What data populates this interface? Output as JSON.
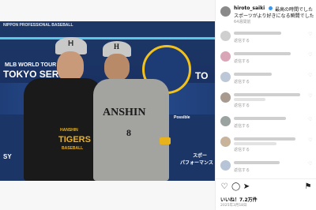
{
  "post": {
    "photo_alt": "Two baseball players posing in front of a stadium backdrop",
    "backdrop": {
      "top_text": "NIPPON PROFESSIONAL BASEBALL",
      "mlb_text": "MLB WORLD TOUR",
      "tokyo_text": "TOKYO SERIES",
      "right_text": "TO",
      "sponsor_left": "SY",
      "sponsor_right_1": "スポー",
      "sponsor_right_2": "パフォーマンス",
      "possible_text": "Possible"
    },
    "player_left": {
      "cap_logo": "H",
      "hoodie_line1": "HANSHIN",
      "hoodie_line2": "TIGERS",
      "hoodie_line3": "BASEBALL"
    },
    "player_right": {
      "cap_logo": "H",
      "jersey_text": "ANSHIN",
      "jersey_number": "8"
    }
  },
  "sidebar": {
    "username": "hiroto_saiki",
    "caption_line1": "最高の時間でした",
    "caption_line2": "スポーツがより好きになる瞬間でした",
    "caption_meta": "64週間前",
    "comments": [
      {
        "meta": "返信する"
      },
      {
        "meta": "返信する"
      },
      {
        "meta": "返信する"
      },
      {
        "meta": "返信する"
      },
      {
        "meta": "返信する"
      },
      {
        "meta": "返信する"
      },
      {
        "meta": "返信する"
      }
    ],
    "likes": "いいね！7.2万件",
    "date": "2025年3月18日",
    "icons": [
      "heart-icon",
      "comment-icon",
      "share-icon",
      "bookmark-icon"
    ]
  },
  "colors": {
    "verified": "#3897f0",
    "tigers_yellow": "#e9b024",
    "stadium_navy": "#1a3566"
  }
}
